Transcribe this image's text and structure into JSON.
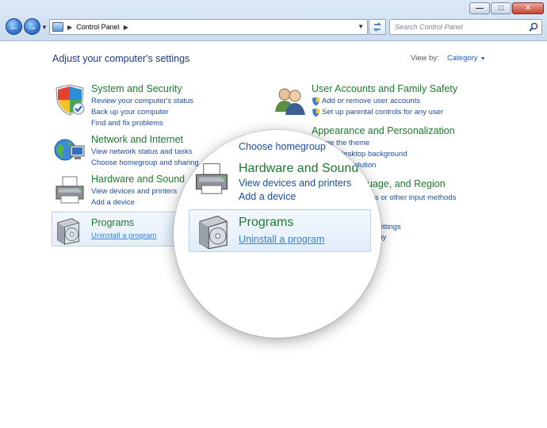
{
  "toolbar": {
    "breadcrumb": "Control Panel",
    "search_placeholder": "Search Control Panel"
  },
  "header": {
    "title": "Adjust your computer's settings",
    "view_by_label": "View by:",
    "view_by_value": "Category"
  },
  "categories": [
    {
      "title": "System and Security",
      "icon": "shield-icon",
      "links": [
        "Review your computer's status",
        "Back up your computer",
        "Find and fix problems"
      ]
    },
    {
      "title": "Network and Internet",
      "icon": "globe-network-icon",
      "links": [
        "View network status and tasks",
        "Choose homegroup and sharing"
      ]
    },
    {
      "title": "Hardware and Sound",
      "icon": "printer-icon",
      "links": [
        "View devices and printers",
        "Add a device"
      ]
    },
    {
      "title": "Programs",
      "icon": "programs-icon",
      "links": [
        "Uninstall a program"
      ]
    },
    {
      "title": "User Accounts and Family Safety",
      "icon": "users-icon",
      "links": [
        "Add or remove user accounts",
        "Set up parental controls for any user"
      ]
    },
    {
      "title": "Appearance and Personalization",
      "icon": "appearance-icon",
      "links": [
        "hange the theme",
        "desktop background",
        "en resolution"
      ]
    },
    {
      "title": "uage, and Region",
      "icon": "clock-region-icon",
      "links": [
        "s or other input methods"
      ]
    },
    {
      "title": "",
      "icon": "ease-of-access-icon",
      "links": [
        "st settings",
        "play"
      ]
    }
  ],
  "magnifier": {
    "top_link": "Choose homegroup",
    "section_title": "Hardware and Sound",
    "links": [
      "View devices and printers",
      "Add a device"
    ],
    "programs_title": "Programs",
    "programs_link": "Uninstall a program"
  },
  "colors": {
    "category_title": "#1e7b2e",
    "link": "#1d4ea0",
    "hover_link": "#3a82d6",
    "highlight_border": "#b6d2f0"
  }
}
